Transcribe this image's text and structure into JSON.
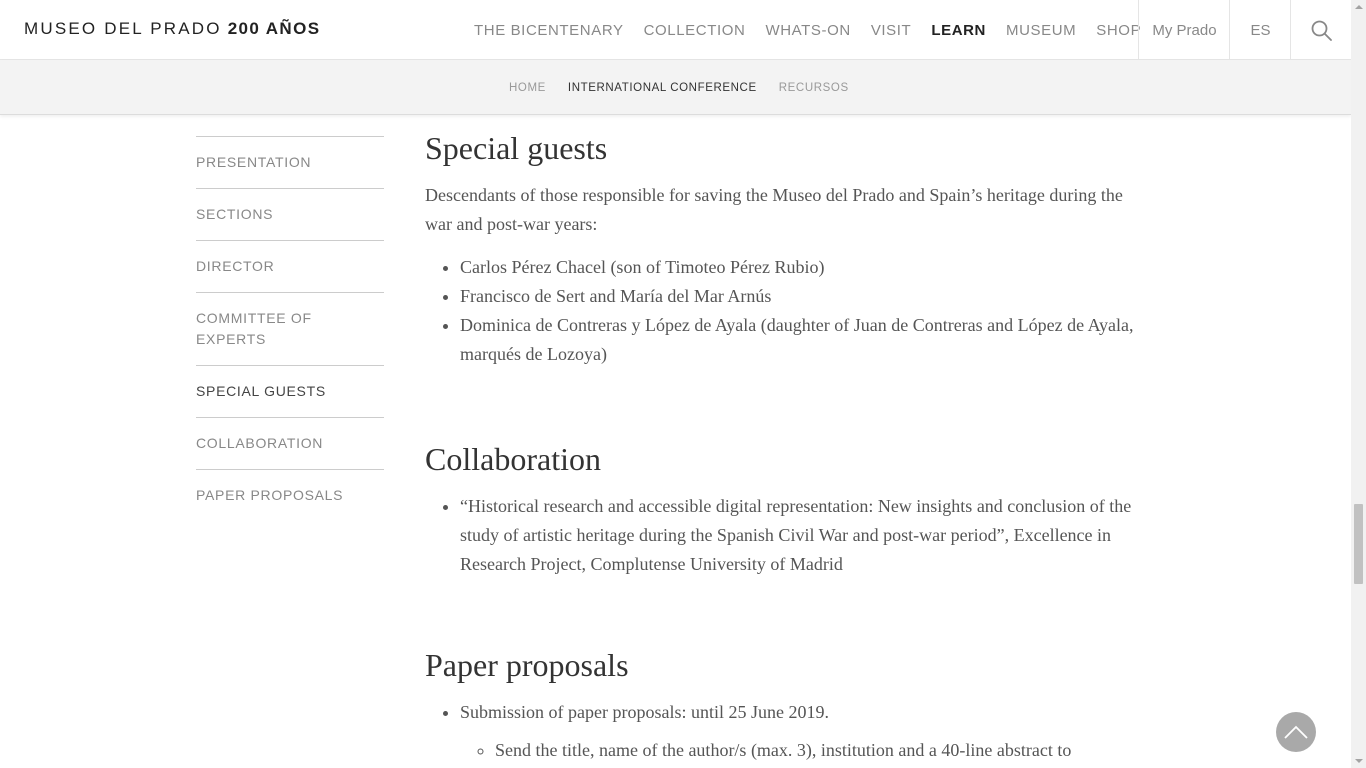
{
  "header": {
    "logo_text": "MUSEO DEL PRADO",
    "logo_strong": "200 AÑOS",
    "nav": [
      {
        "label": "THE BICENTENARY"
      },
      {
        "label": "COLLECTION"
      },
      {
        "label": "WHATS-ON"
      },
      {
        "label": "VISIT"
      },
      {
        "label": "LEARN"
      },
      {
        "label": "MUSEUM"
      },
      {
        "label": "SHOP"
      }
    ],
    "my_prado": "My Prado",
    "language": "ES",
    "search_icon": "search-icon"
  },
  "subnav": {
    "items": [
      {
        "label": "HOME"
      },
      {
        "label": "INTERNATIONAL CONFERENCE"
      },
      {
        "label": "RECURSOS"
      }
    ]
  },
  "sidebar": {
    "items": [
      {
        "label": "PRESENTATION"
      },
      {
        "label": "SECTIONS"
      },
      {
        "label": "DIRECTOR"
      },
      {
        "label": "COMMITTEE OF EXPERTS"
      },
      {
        "label": "SPECIAL GUESTS"
      },
      {
        "label": "COLLABORATION"
      },
      {
        "label": "PAPER PROPOSALS"
      }
    ]
  },
  "content": {
    "special_guests": {
      "title": "Special guests",
      "intro": "Descendants of those responsible for saving the Museo del Prado and Spain’s heritage during the war and post-war years:",
      "items": [
        "Carlos Pérez Chacel (son of Timoteo Pérez Rubio)",
        "Francisco de Sert and María del Mar Arnús",
        "Dominica de Contreras y López de Ayala (daughter of Juan de Contreras and López de Ayala, marqués de Lozoya)"
      ]
    },
    "collaboration": {
      "title": "Collaboration",
      "items": [
        "“Historical research and accessible digital representation: New insights and conclusion of the study of artistic heritage during the Spanish Civil War and post-war period”, Excellence in Research Project, Complutense University of Madrid"
      ]
    },
    "paper_proposals": {
      "title": "Paper proposals",
      "item": "Submission of paper proposals: until 25 June 2019.",
      "subitem": "Send the title, name of the author/s (max. 3), institution and a 40-line abstract to"
    }
  },
  "icons": {
    "back_to_top": "chevron-up-icon"
  }
}
